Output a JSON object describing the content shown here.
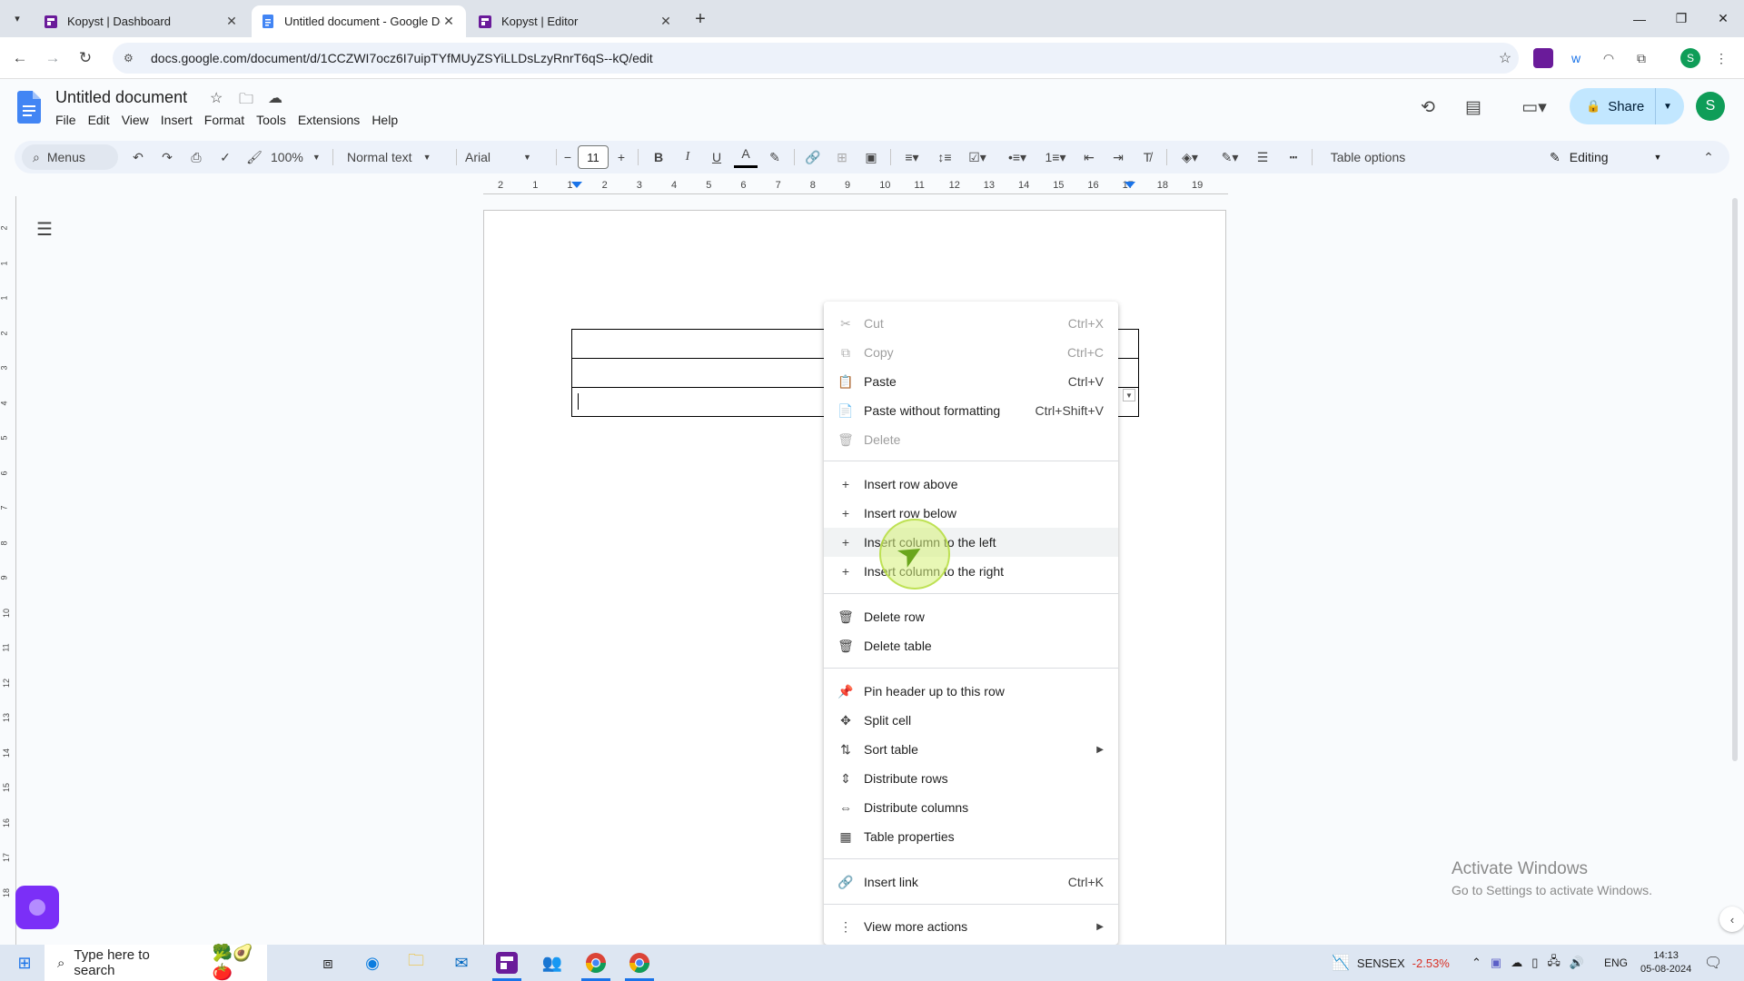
{
  "browser": {
    "tabs": [
      {
        "title": "Kopyst | Dashboard"
      },
      {
        "title": "Untitled document - Google Do"
      },
      {
        "title": "Kopyst | Editor"
      }
    ],
    "url": "docs.google.com/document/d/1CCZWI7ocz6I7uipTYfMUyZSYiLLDsLzyRnrT6qS--kQ/edit"
  },
  "docs": {
    "title": "Untitled document",
    "menu": [
      "File",
      "Edit",
      "View",
      "Insert",
      "Format",
      "Tools",
      "Extensions",
      "Help"
    ],
    "share_label": "Share",
    "avatar_letter": "S"
  },
  "toolbar": {
    "menus_label": "Menus",
    "zoom": "100%",
    "style": "Normal text",
    "font": "Arial",
    "font_size": "11",
    "table_options": "Table options",
    "mode": "Editing"
  },
  "ruler": {
    "h_ticks": [
      "2",
      "1",
      "1",
      "2",
      "3",
      "4",
      "5",
      "6",
      "7",
      "8",
      "9",
      "10",
      "11",
      "12",
      "13",
      "14",
      "15",
      "16",
      "17",
      "18",
      "19"
    ],
    "v_ticks": [
      "2",
      "1",
      "1",
      "2",
      "3",
      "4",
      "5",
      "6",
      "7",
      "8",
      "9",
      "10",
      "11",
      "12",
      "13",
      "14",
      "15",
      "16",
      "17",
      "18"
    ]
  },
  "context_menu": {
    "items": [
      {
        "icon": "scissors-icon",
        "label": "Cut",
        "shortcut": "Ctrl+X",
        "disabled": true
      },
      {
        "icon": "copy-icon",
        "label": "Copy",
        "shortcut": "Ctrl+C",
        "disabled": true
      },
      {
        "icon": "paste-icon",
        "label": "Paste",
        "shortcut": "Ctrl+V",
        "disabled": false
      },
      {
        "icon": "paste-plain-icon",
        "label": "Paste without formatting",
        "shortcut": "Ctrl+Shift+V",
        "disabled": false
      },
      {
        "icon": "trash-icon",
        "label": "Delete",
        "shortcut": "",
        "disabled": true
      },
      {
        "icon": "plus-icon",
        "label": "Insert row above",
        "shortcut": "",
        "disabled": false
      },
      {
        "icon": "plus-icon",
        "label": "Insert row below",
        "shortcut": "",
        "disabled": false
      },
      {
        "icon": "plus-icon",
        "label": "Insert column to the left",
        "shortcut": "",
        "disabled": false
      },
      {
        "icon": "plus-icon",
        "label": "Insert column to the right",
        "shortcut": "",
        "disabled": false
      },
      {
        "icon": "trash-icon",
        "label": "Delete row",
        "shortcut": "",
        "disabled": false
      },
      {
        "icon": "trash-icon",
        "label": "Delete table",
        "shortcut": "",
        "disabled": false
      },
      {
        "icon": "pin-icon",
        "label": "Pin header up to this row",
        "shortcut": "",
        "disabled": false
      },
      {
        "icon": "split-cell-icon",
        "label": "Split cell",
        "shortcut": "",
        "disabled": false
      },
      {
        "icon": "sort-icon",
        "label": "Sort table",
        "shortcut": "",
        "disabled": false
      },
      {
        "icon": "distribute-rows-icon",
        "label": "Distribute rows",
        "shortcut": "",
        "disabled": false
      },
      {
        "icon": "distribute-columns-icon",
        "label": "Distribute columns",
        "shortcut": "",
        "disabled": false
      },
      {
        "icon": "table-icon",
        "label": "Table properties",
        "shortcut": "",
        "disabled": false
      },
      {
        "icon": "link-icon",
        "label": "Insert link",
        "shortcut": "Ctrl+K",
        "disabled": false
      },
      {
        "icon": "more-vert-icon",
        "label": "View more actions",
        "shortcut": "",
        "disabled": false
      }
    ]
  },
  "watermark": {
    "line1": "Activate Windows",
    "line2": "Go to Settings to activate Windows."
  },
  "taskbar": {
    "search_placeholder": "Type here to search",
    "stock_name": "SENSEX",
    "stock_change": "-2.53%",
    "lang": "ENG",
    "time": "14:13",
    "date": "05-08-2024"
  },
  "colors": {
    "accent": "#1a73e8",
    "share_bg": "#c2e7ff",
    "stock_negative": "#d93025",
    "assistant_purple": "#7b2ff7"
  }
}
